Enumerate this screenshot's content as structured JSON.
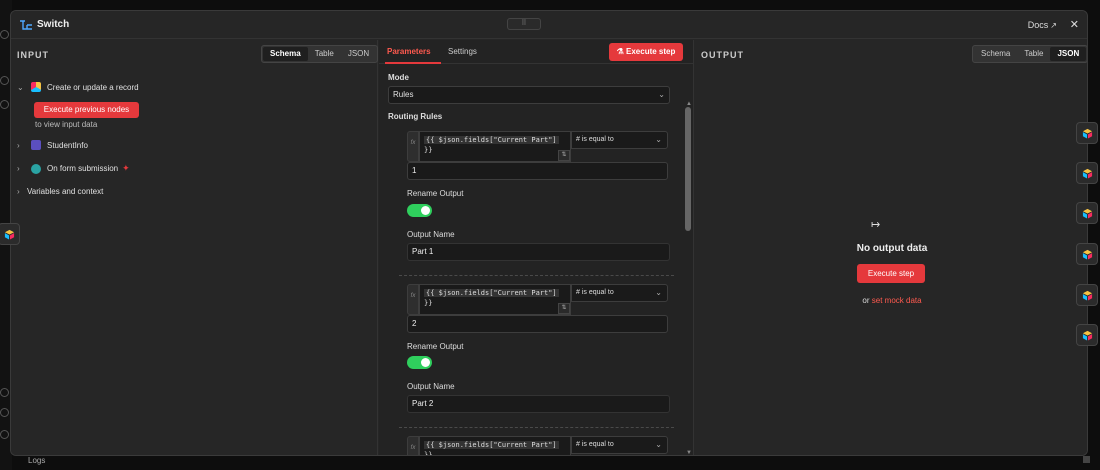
{
  "title": "Switch",
  "header": {
    "docs_label": "Docs",
    "docs_icon": "external-link-icon",
    "close_icon": "close-icon"
  },
  "input": {
    "label": "INPUT",
    "views": [
      "Schema",
      "Table",
      "JSON"
    ],
    "active_view": "Schema",
    "tree": [
      {
        "label": "Create or update a record",
        "expanded": true
      },
      {
        "label": "StudentInfo",
        "expanded": false
      },
      {
        "label": "On form submission",
        "expanded": false
      },
      {
        "label": "Variables and context",
        "expanded": false
      }
    ],
    "execute_previous": "Execute previous nodes",
    "view_hint": "to view input data"
  },
  "params": {
    "tabs": [
      "Parameters",
      "Settings"
    ],
    "active_tab": "Parameters",
    "execute_label": "Execute step",
    "mode_label": "Mode",
    "mode_value": "Rules",
    "routing_label": "Routing Rules",
    "rules": [
      {
        "expr_code": "{{ $json.fields[\"Current Part\"]",
        "expr_end": "}}",
        "operator": "# is equal to",
        "value": "1",
        "rename_label": "Rename Output",
        "rename_on": true,
        "output_name_label": "Output Name",
        "output_name": "Part 1"
      },
      {
        "expr_code": "{{ $json.fields[\"Current Part\"]",
        "expr_end": "}}",
        "operator": "# is equal to",
        "value": "2",
        "rename_label": "Rename Output",
        "rename_on": true,
        "output_name_label": "Output Name",
        "output_name": "Part 2"
      },
      {
        "expr_code": "{{ $json.fields[\"Current Part\"]",
        "expr_end": "}}",
        "operator": "# is equal to"
      }
    ]
  },
  "output": {
    "label": "OUTPUT",
    "views": [
      "Schema",
      "Table",
      "JSON"
    ],
    "active_view": "JSON",
    "empty_title": "No output data",
    "execute_label": "Execute step",
    "mock_prefix": "or",
    "mock_link": "set mock data"
  },
  "footer": {
    "logs_label": "Logs"
  },
  "colors": {
    "accent": "#e5393c",
    "toggle_on": "#2fcf5d",
    "link": "#ff5a4f"
  }
}
